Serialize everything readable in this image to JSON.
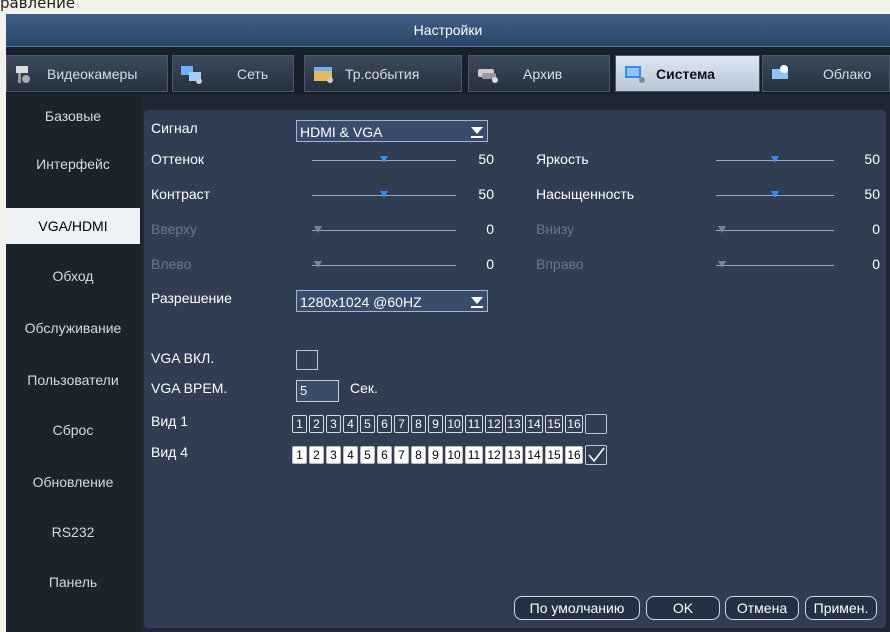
{
  "heading_fragment": "равление",
  "window": {
    "title": "Настройки"
  },
  "tabs": [
    {
      "label": "Видеокамеры",
      "icon": "camera-icon"
    },
    {
      "label": "Сеть",
      "icon": "network-icon"
    },
    {
      "label": "Тр.события",
      "icon": "events-icon"
    },
    {
      "label": "Архив",
      "icon": "archive-icon"
    },
    {
      "label": "Система",
      "icon": "system-icon",
      "active": true
    },
    {
      "label": "Облако",
      "icon": "cloud-icon"
    }
  ],
  "sidebar": [
    {
      "label": "Базовые"
    },
    {
      "label": "Интерфейс"
    },
    {
      "label": "VGA/HDMI",
      "active": true
    },
    {
      "label": "Обход"
    },
    {
      "label": "Обслуживание"
    },
    {
      "label": "Пользователи"
    },
    {
      "label": "Сброс"
    },
    {
      "label": "Обновление"
    },
    {
      "label": "RS232"
    },
    {
      "label": "Панель"
    }
  ],
  "form": {
    "signal_label": "Сигнал",
    "signal_value": "HDMI & VGA",
    "hue_label": "Оттенок",
    "hue_value": "50",
    "brightness_label": "Яркость",
    "brightness_value": "50",
    "contrast_label": "Контраст",
    "contrast_value": "50",
    "saturation_label": "Насыщенность",
    "saturation_value": "50",
    "top_label": "Вверху",
    "top_value": "0",
    "bottom_label": "Внизу",
    "bottom_value": "0",
    "left_label": "Влево",
    "left_value": "0",
    "right_label": "Вправо",
    "right_value": "0",
    "resolution_label": "Разрешение",
    "resolution_value": "1280x1024 @60HZ",
    "vga_on_label": "VGA ВКЛ.",
    "vga_on_checked": false,
    "vga_time_label": "VGA ВРЕМ.",
    "vga_time_value": "5",
    "vga_time_unit": "Сек.",
    "view1_label": "Вид 1",
    "view1_channels": [
      "1",
      "2",
      "3",
      "4",
      "5",
      "6",
      "7",
      "8",
      "9",
      "10",
      "11",
      "12",
      "13",
      "14",
      "15",
      "16"
    ],
    "view1_checked": false,
    "view4_label": "Вид 4",
    "view4_channels": [
      "1",
      "2",
      "3",
      "4",
      "5",
      "6",
      "7",
      "8",
      "9",
      "10",
      "11",
      "12",
      "13",
      "14",
      "15",
      "16"
    ],
    "view4_checked": true
  },
  "buttons": {
    "default": "По умолчанию",
    "ok": "OK",
    "cancel": "Отмена",
    "apply": "Примен."
  },
  "colors": {
    "accent": "#2f8cff",
    "panel": "#313d52",
    "window": "#1e2733"
  }
}
